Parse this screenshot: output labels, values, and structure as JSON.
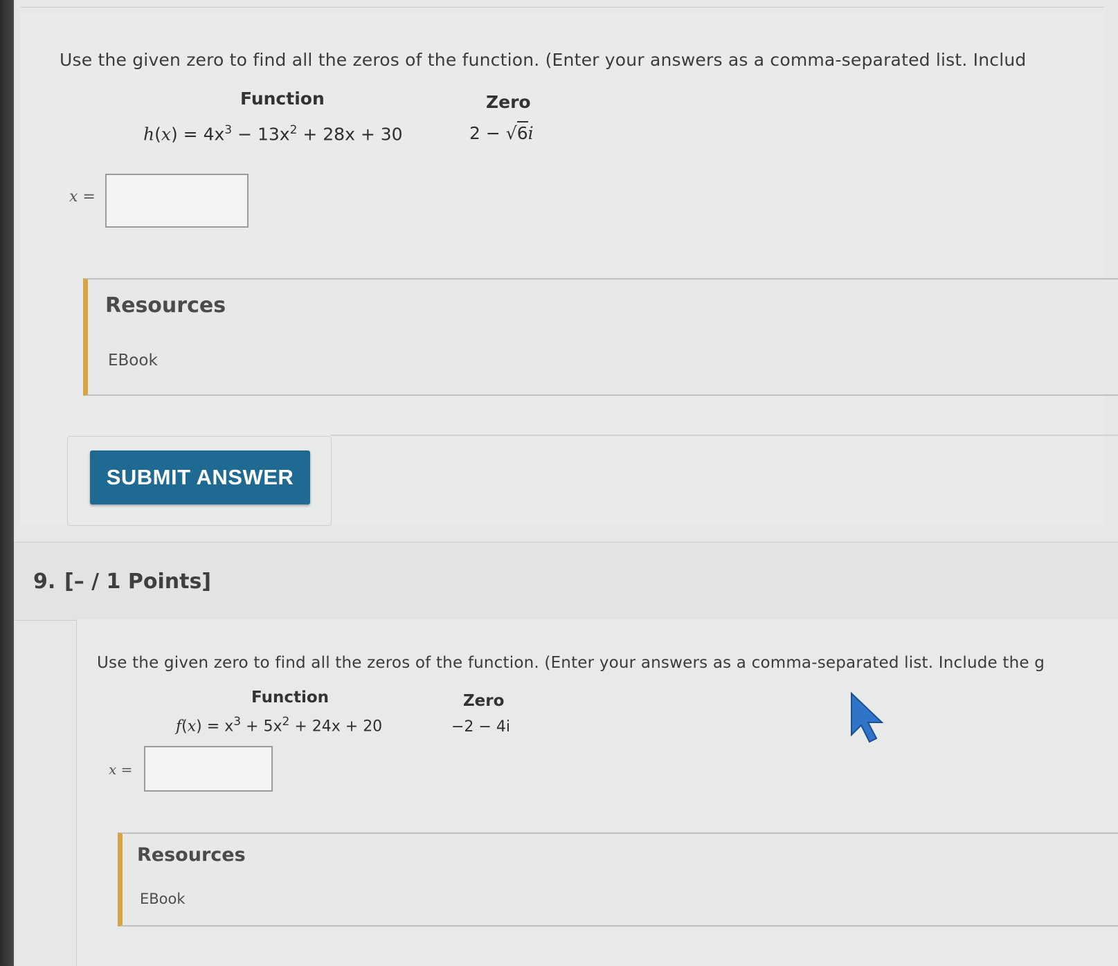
{
  "question8": {
    "instruction": "Use the given zero to find all the zeros of the function. (Enter your answers as a comma-separated list. Includ",
    "function_header": "Function",
    "zero_header": "Zero",
    "function_name": "h",
    "function_var": "x",
    "function_rhs_terms": [
      "4x",
      "3",
      "− 13x",
      "2",
      "+ 28x + 30"
    ],
    "zero_prefix": "2 −",
    "zero_radicand": "6",
    "zero_suffix": "i",
    "answer_label": "x =",
    "answer_value": ""
  },
  "resources8": {
    "title": "Resources",
    "link": "EBook"
  },
  "submit": {
    "label": "SUBMIT ANSWER"
  },
  "question9": {
    "number": "9.",
    "points": "[– / 1 Points]",
    "instruction": "Use the given zero to find all the zeros of the function. (Enter your answers as a comma-separated list. Include the g",
    "function_header": "Function",
    "zero_header": "Zero",
    "function_name": "f",
    "function_var": "x",
    "function_rhs_terms": [
      "x",
      "3",
      "+ 5x",
      "2",
      "+ 24x + 20"
    ],
    "zero": "−2 − 4i",
    "answer_label": "x =",
    "answer_value": ""
  },
  "resources9": {
    "title": "Resources",
    "link": "EBook"
  },
  "colors": {
    "submit_bg": "#1f6a93",
    "resources_accent": "#d9a441",
    "cursor": "#2f74c8"
  },
  "icons": {
    "cursor": "mouse-pointer-icon"
  }
}
